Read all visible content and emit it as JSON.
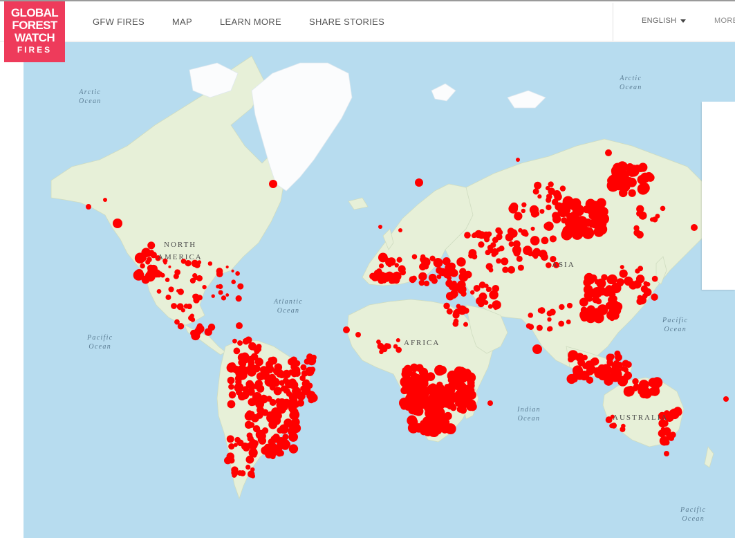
{
  "logo": {
    "lines": [
      "GLOBAL",
      "FOREST",
      "WATCH",
      "FIRES"
    ]
  },
  "nav": {
    "items": [
      "GFW FIRES",
      "MAP",
      "LEARN MORE",
      "SHARE STORIES"
    ]
  },
  "language": {
    "label": "ENGLISH"
  },
  "more": {
    "label": "MORE"
  },
  "map": {
    "ocean_labels": [
      {
        "line1": "Arctic",
        "line2": "Ocean"
      },
      {
        "line1": "Arctic",
        "line2": "Ocean"
      },
      {
        "line1": "Atlantic",
        "line2": "Ocean"
      },
      {
        "line1": "Pacific",
        "line2": "Ocean"
      },
      {
        "line1": "Pacific",
        "line2": "Ocean"
      },
      {
        "line1": "Indian",
        "line2": "Ocean"
      },
      {
        "line1": "Pacific",
        "line2": "Ocean"
      }
    ],
    "continent_labels": [
      "NORTH",
      "AMERICA",
      "AFRICA",
      "ASIA",
      "AUSTRALIA"
    ],
    "colors": {
      "ocean": "#b7dcef",
      "land": "#e7f0d8",
      "ice": "#fbfcfd",
      "fire": "#ff0000"
    }
  }
}
